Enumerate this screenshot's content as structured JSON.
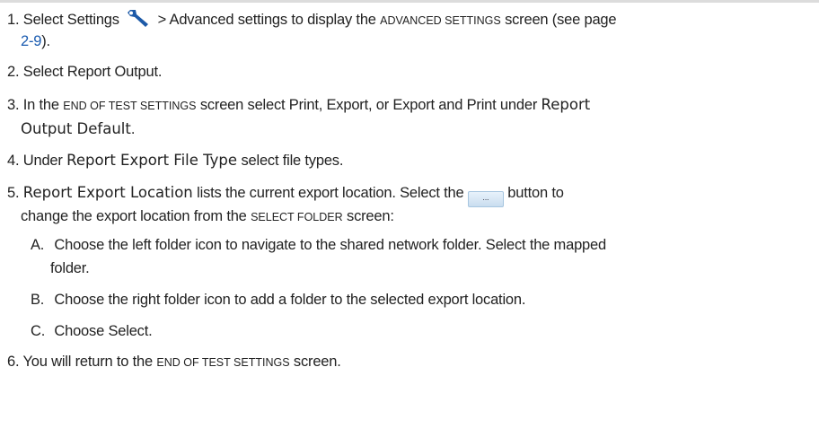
{
  "steps": {
    "s1": {
      "num": "1.",
      "a": "Select Settings",
      "icon": "wrench-icon",
      "b": "> Advanced settings to display the",
      "screen": "Advanced settings",
      "c": "screen (see page",
      "page_link": "2-9",
      "d": ")."
    },
    "s2": {
      "num": "2.",
      "text": "Select Report Output."
    },
    "s3": {
      "num": "3.",
      "a": "In the",
      "screen": "End of Test Settings",
      "b": "screen select Print, Export, or Export and Print under",
      "em1": "Report",
      "em2": "Output Default",
      "c": "."
    },
    "s4": {
      "num": "4.",
      "a": "Under",
      "em": "Report Export File Type",
      "b": "select file types."
    },
    "s5": {
      "num": "5.",
      "em": "Report Export Location",
      "a": "lists the current export location. Select the",
      "button_label": "...",
      "b": "button to",
      "c": "change the export location from the",
      "screen": "Select folder",
      "d": "screen:"
    },
    "substeps": [
      {
        "letter": "A.",
        "line1": "Choose the left folder icon to navigate to the shared network folder. Select the mapped",
        "line2": "folder."
      },
      {
        "letter": "B.",
        "line1": "Choose the right folder icon to add a folder to the selected export location."
      },
      {
        "letter": "C.",
        "line1": "Choose Select."
      }
    ],
    "s6": {
      "num": "6.",
      "a": "You will return to the",
      "screen": "End of Test Settings",
      "b": "screen."
    }
  }
}
